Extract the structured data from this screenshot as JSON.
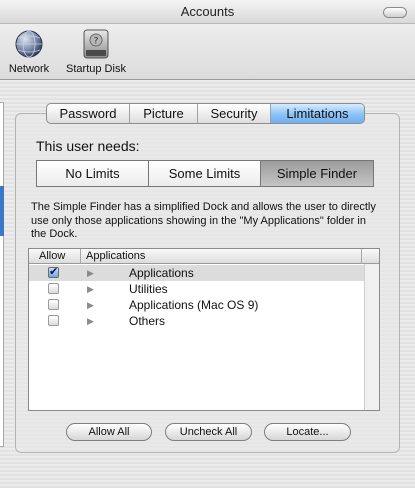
{
  "window": {
    "title": "Accounts"
  },
  "toolbar": {
    "items": [
      {
        "label": "Network",
        "icon": "network-globe-icon"
      },
      {
        "label": "Startup Disk",
        "icon": "hard-disk-icon"
      }
    ]
  },
  "tabs": [
    {
      "label": "Password",
      "active": false
    },
    {
      "label": "Picture",
      "active": false
    },
    {
      "label": "Security",
      "active": false
    },
    {
      "label": "Limitations",
      "active": true
    }
  ],
  "limitations": {
    "needs_label": "This user needs:",
    "levels": [
      {
        "label": "No Limits",
        "selected": false
      },
      {
        "label": "Some Limits",
        "selected": false
      },
      {
        "label": "Simple Finder",
        "selected": true
      }
    ],
    "description": "The Simple Finder has a simplified Dock and allows the user to directly use only those applications showing in the \"My Applications\" folder in the Dock."
  },
  "table": {
    "columns": [
      "Allow",
      "Applications"
    ],
    "rows": [
      {
        "label": "Applications",
        "allowed": true
      },
      {
        "label": "Utilities",
        "allowed": false
      },
      {
        "label": "Applications (Mac OS 9)",
        "allowed": false
      },
      {
        "label": "Others",
        "allowed": false
      }
    ]
  },
  "buttons": {
    "allow_all": "Allow All",
    "uncheck_all": "Uncheck All",
    "locate": "Locate..."
  },
  "colors": {
    "selection_blue": "#6eaef0",
    "sidebar_selection": "#3a78c7"
  }
}
